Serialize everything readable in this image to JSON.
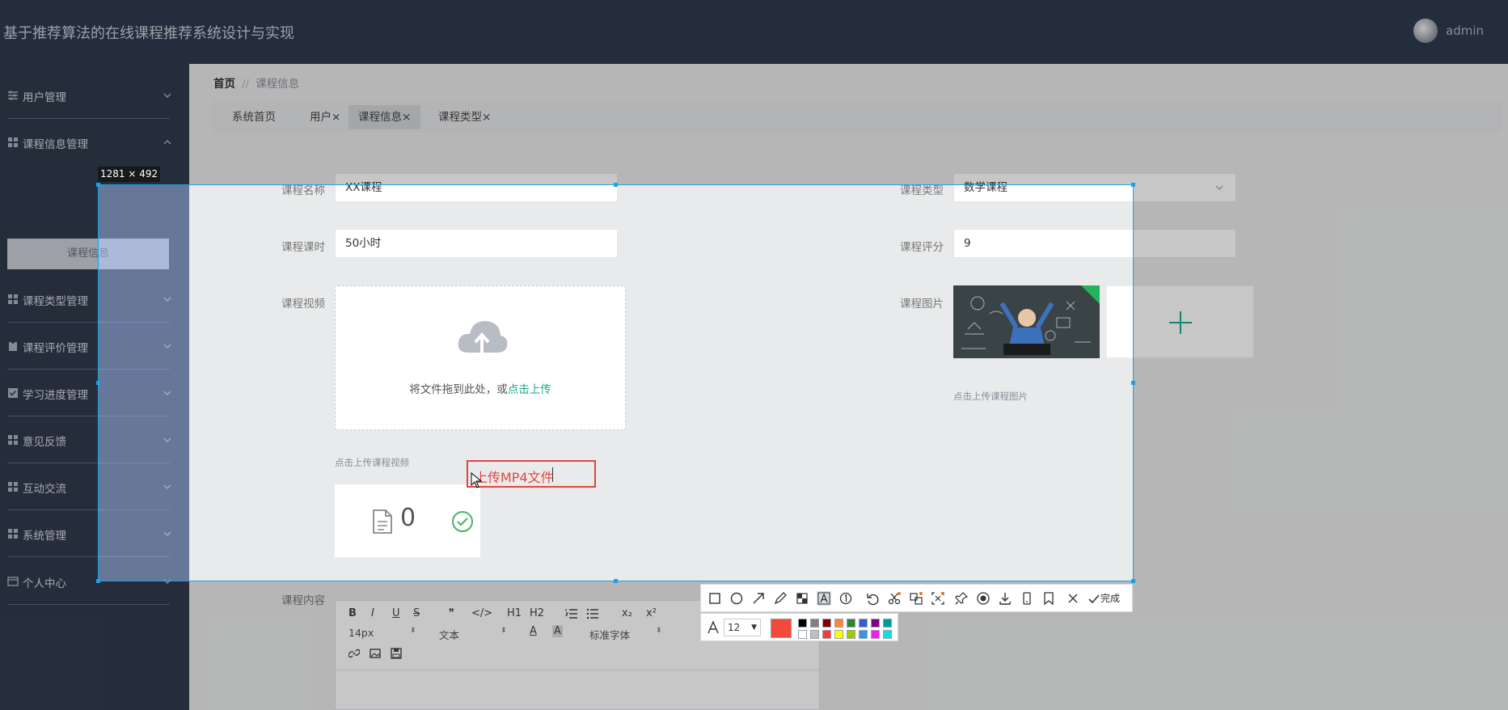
{
  "header": {
    "app_title": "基于推荐算法的在线课程推荐系统设计与实现",
    "user_name": "admin"
  },
  "sidebar": {
    "items": [
      {
        "label": "用户管理",
        "icon": "sliders-icon"
      },
      {
        "label": "课程信息管理",
        "icon": "grid-icon",
        "expanded": true
      },
      {
        "label": "课程类型管理",
        "icon": "grid-icon"
      },
      {
        "label": "课程评价管理",
        "icon": "clipboard-icon"
      },
      {
        "label": "学习进度管理",
        "icon": "checkbox-icon"
      },
      {
        "label": "意见反馈",
        "icon": "grid-icon"
      },
      {
        "label": "互动交流",
        "icon": "grid-icon"
      },
      {
        "label": "系统管理",
        "icon": "grid-icon"
      },
      {
        "label": "个人中心",
        "icon": "wallet-icon"
      }
    ],
    "sub_item_active": "课程信息"
  },
  "breadcrumb": {
    "home": "首页",
    "separator": "//",
    "current": "课程信息"
  },
  "tabs": [
    {
      "label": "系统首页",
      "closable": false
    },
    {
      "label": "用户",
      "closable": true
    },
    {
      "label": "课程信息",
      "closable": true,
      "active": true
    },
    {
      "label": "课程类型",
      "closable": true
    }
  ],
  "tab_close_glyph": "×",
  "form": {
    "course_name": {
      "label": "课程名称",
      "value": "XX课程"
    },
    "course_type": {
      "label": "课程类型",
      "value": "数学课程"
    },
    "course_hours": {
      "label": "课程课时",
      "value": "50小时"
    },
    "course_rating": {
      "label": "课程评分",
      "value": "9"
    },
    "course_video": {
      "label": "课程视频",
      "drag_text": "将文件拖到此处，或",
      "link_text": "点击上传",
      "hint": "点击上传课程视频",
      "file_count": "0"
    },
    "course_image": {
      "label": "课程图片",
      "hint": "点击上传课程图片"
    },
    "course_content": {
      "label": "课程内容"
    }
  },
  "editor": {
    "buttons_row1": [
      "B",
      "I",
      "U",
      "S",
      "❞",
      "</>",
      "H1",
      "H2"
    ],
    "font_size": "14px",
    "text_style": "文本",
    "font_family": "标准字体"
  },
  "capture": {
    "size_label": "1281 × 492",
    "annotation_text": "上传MP4文件",
    "font_size": "12",
    "done_label": "完成",
    "current_color": "#f04a3c",
    "palette": [
      "#000000",
      "#808080",
      "#800000",
      "#f7883a",
      "#308430",
      "#385ad3",
      "#800080",
      "#009999",
      "#ffffff",
      "#c0c0c0",
      "#fb3838",
      "#ffff00",
      "#99cc00",
      "#3894e4",
      "#f31bf3",
      "#16dcdc"
    ]
  },
  "colors": {
    "accent": "#1aaa8f",
    "header_bg": "#2f3a4d",
    "sidebar_bg": "#313a4b",
    "selection": "#19a3e6",
    "annotation": "#e2453c"
  }
}
